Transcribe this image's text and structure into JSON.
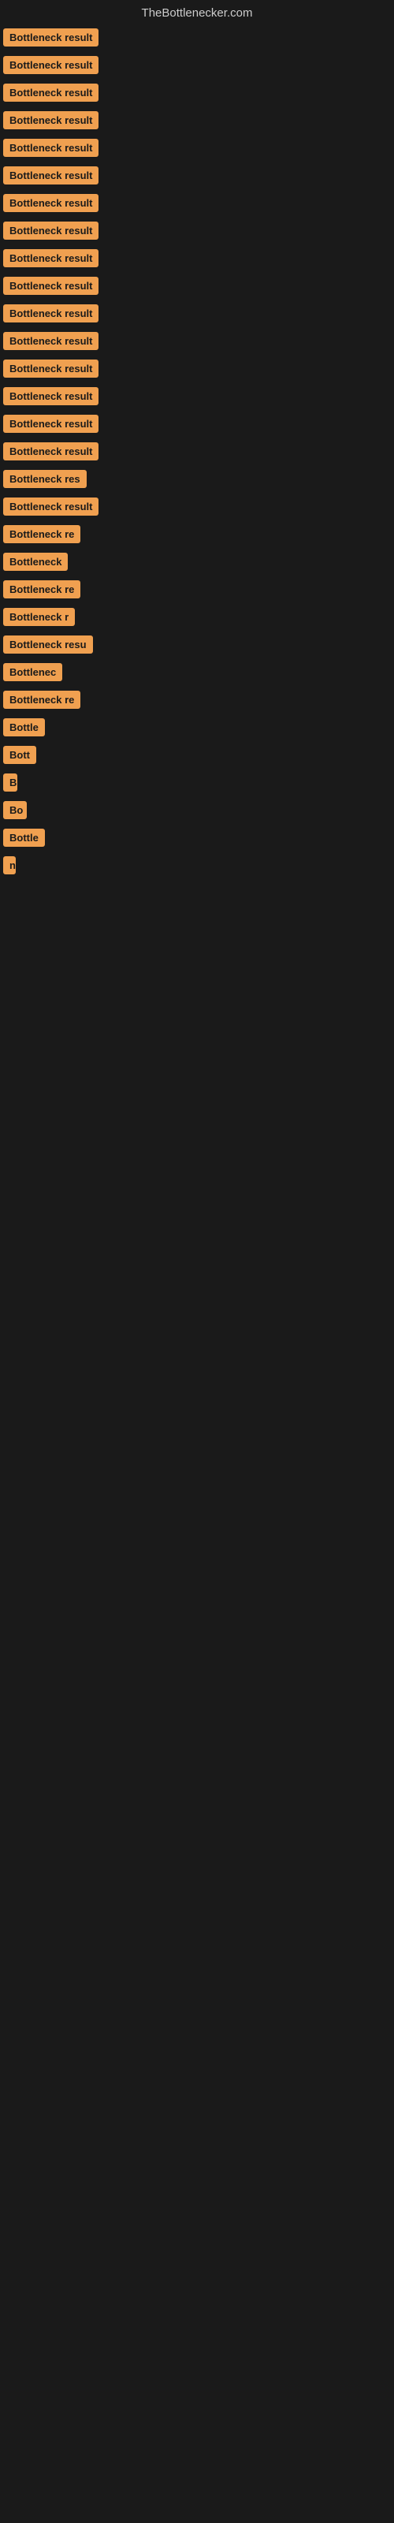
{
  "header": {
    "title": "TheBottlenecker.com"
  },
  "items": [
    {
      "label": "Bottleneck result",
      "width": 145
    },
    {
      "label": "Bottleneck result",
      "width": 145
    },
    {
      "label": "Bottleneck result",
      "width": 145
    },
    {
      "label": "Bottleneck result",
      "width": 145
    },
    {
      "label": "Bottleneck result",
      "width": 145
    },
    {
      "label": "Bottleneck result",
      "width": 145
    },
    {
      "label": "Bottleneck result",
      "width": 145
    },
    {
      "label": "Bottleneck result",
      "width": 145
    },
    {
      "label": "Bottleneck result",
      "width": 145
    },
    {
      "label": "Bottleneck result",
      "width": 145
    },
    {
      "label": "Bottleneck result",
      "width": 145
    },
    {
      "label": "Bottleneck result",
      "width": 145
    },
    {
      "label": "Bottleneck result",
      "width": 145
    },
    {
      "label": "Bottleneck result",
      "width": 145
    },
    {
      "label": "Bottleneck result",
      "width": 145
    },
    {
      "label": "Bottleneck result",
      "width": 145
    },
    {
      "label": "Bottleneck res",
      "width": 120
    },
    {
      "label": "Bottleneck result",
      "width": 145
    },
    {
      "label": "Bottleneck re",
      "width": 110
    },
    {
      "label": "Bottleneck",
      "width": 90
    },
    {
      "label": "Bottleneck re",
      "width": 110
    },
    {
      "label": "Bottleneck r",
      "width": 100
    },
    {
      "label": "Bottleneck resu",
      "width": 122
    },
    {
      "label": "Bottlenec",
      "width": 85
    },
    {
      "label": "Bottleneck re",
      "width": 108
    },
    {
      "label": "Bottle",
      "width": 60
    },
    {
      "label": "Bott",
      "width": 48
    },
    {
      "label": "B",
      "width": 18
    },
    {
      "label": "Bo",
      "width": 30
    },
    {
      "label": "Bottle",
      "width": 58
    },
    {
      "label": "n",
      "width": 14
    }
  ]
}
